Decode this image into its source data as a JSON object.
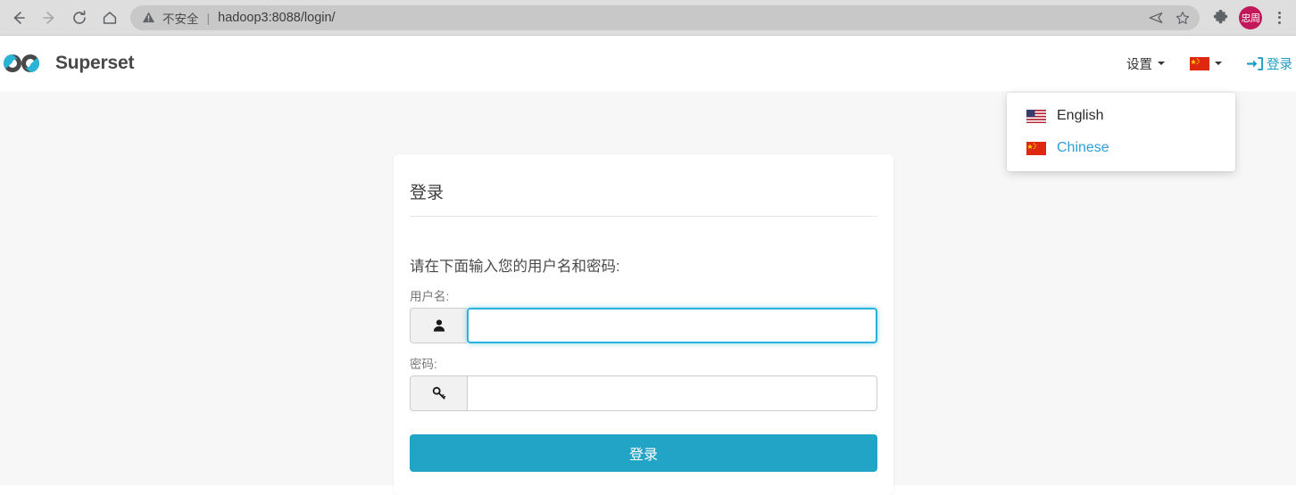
{
  "browser": {
    "back_label": "Back",
    "forward_label": "Forward",
    "reload_label": "Reload",
    "home_label": "Home",
    "security_text": "不安全",
    "separator": "|",
    "url": "hadoop3:8088/login/",
    "share_label": "Share",
    "bookmark_label": "Bookmark",
    "extensions_label": "Extensions",
    "avatar_initials": "忠周",
    "menu_label": "Customize and control"
  },
  "header": {
    "brand_name": "Superset",
    "settings_label": "设置",
    "login_label": "登录"
  },
  "lang_menu": {
    "items": [
      {
        "label": "English",
        "flag": "us-flag-icon",
        "active": false
      },
      {
        "label": "Chinese",
        "flag": "cn-flag-icon",
        "active": true
      }
    ]
  },
  "login_form": {
    "card_title": "登录",
    "intro": "请在下面输入您的用户名和密码:",
    "username_label": "用户名:",
    "username_value": "",
    "username_placeholder": "",
    "password_label": "密码:",
    "password_value": "",
    "password_placeholder": "",
    "submit_label": "登录"
  },
  "colors": {
    "accent": "#22a4c6",
    "focus_border": "#28b2dc",
    "link": "#1f9ec4",
    "avatar_bg": "#c2185b",
    "page_bg": "#f7f7f7"
  }
}
